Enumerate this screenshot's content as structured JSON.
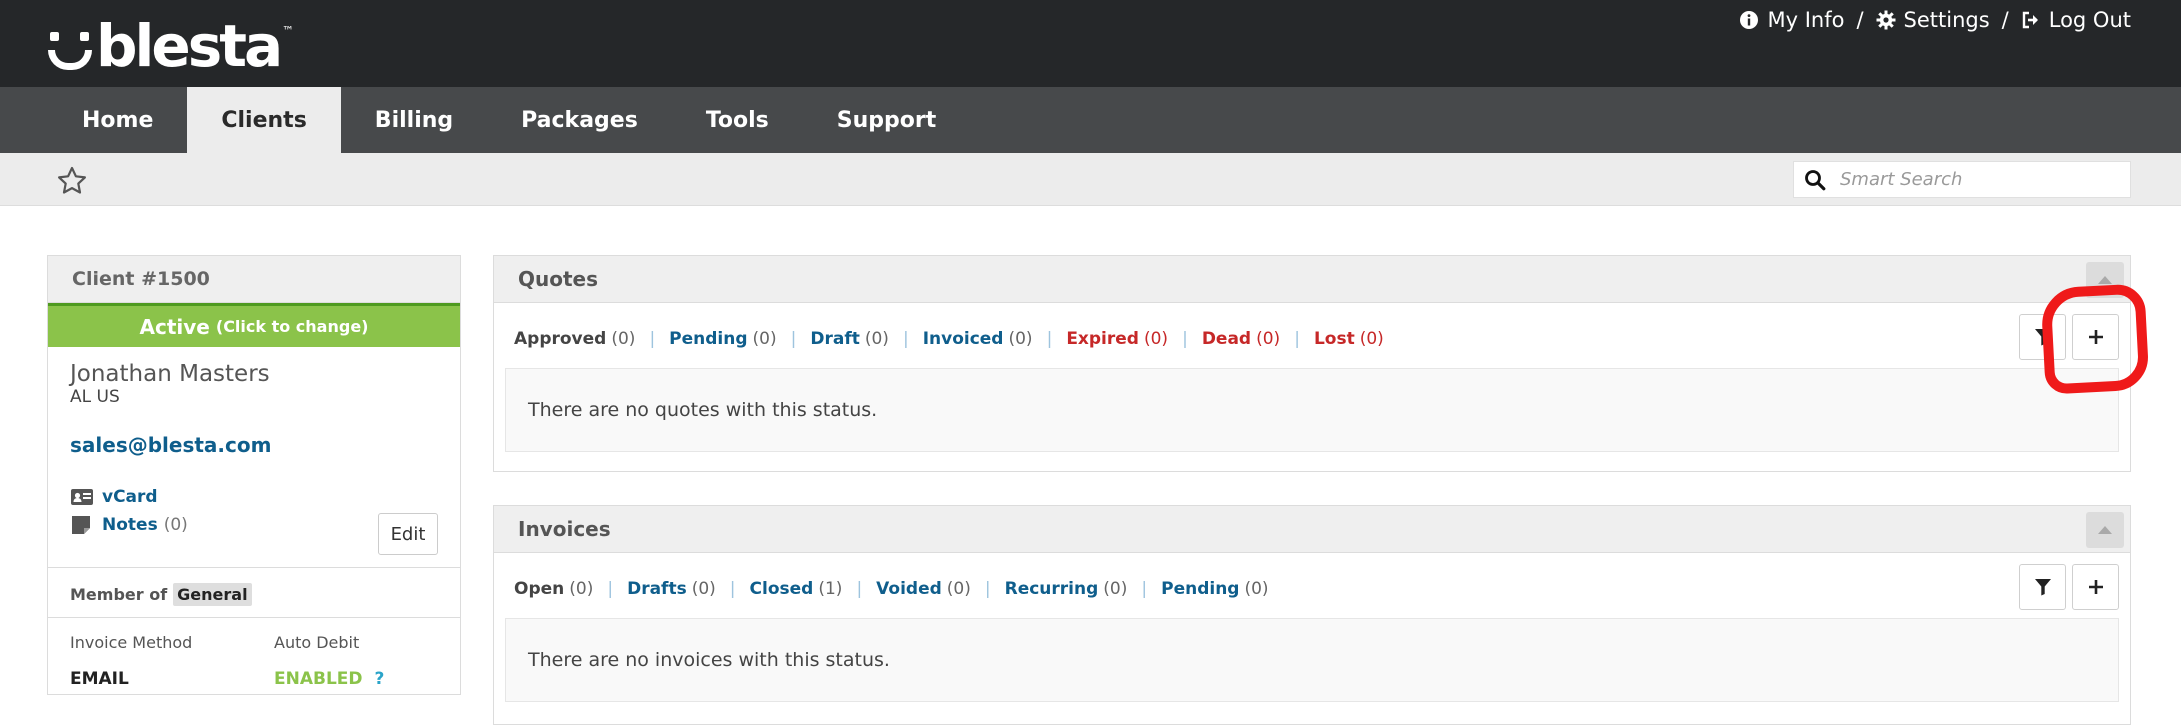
{
  "header": {
    "logo_text": "blesta",
    "logo_tm": "™",
    "links": [
      {
        "label": "My Info",
        "icon": "info-icon"
      },
      {
        "label": "Settings",
        "icon": "gear-icon"
      },
      {
        "label": "Log Out",
        "icon": "logout-icon"
      }
    ],
    "separator": "/"
  },
  "nav": {
    "items": [
      "Home",
      "Clients",
      "Billing",
      "Packages",
      "Tools",
      "Support"
    ],
    "active": "Clients"
  },
  "subbar": {
    "search_placeholder": "Smart Search"
  },
  "client": {
    "title": "Client #1500",
    "status": "Active",
    "status_hint": "(Click to change)",
    "name": "Jonathan Masters",
    "location": "AL US",
    "email": "sales@blesta.com",
    "vcard_label": "vCard",
    "notes_label": "Notes",
    "notes_count": "(0)",
    "edit_label": "Edit",
    "member_of_label": "Member of",
    "group": "General",
    "invoice_method_label": "Invoice Method",
    "invoice_method_value": "EMAIL",
    "auto_debit_label": "Auto Debit",
    "auto_debit_value": "ENABLED",
    "auto_debit_help": "?"
  },
  "quotes": {
    "title": "Quotes",
    "filters": [
      {
        "label": "Approved",
        "count": "(0)",
        "style": "dark"
      },
      {
        "label": "Pending",
        "count": "(0)",
        "style": "blue"
      },
      {
        "label": "Draft",
        "count": "(0)",
        "style": "blue"
      },
      {
        "label": "Invoiced",
        "count": "(0)",
        "style": "blue"
      },
      {
        "label": "Expired",
        "count": "(0)",
        "style": "red"
      },
      {
        "label": "Dead",
        "count": "(0)",
        "style": "red"
      },
      {
        "label": "Lost",
        "count": "(0)",
        "style": "red"
      }
    ],
    "empty_text": "There are no quotes with this status."
  },
  "invoices": {
    "title": "Invoices",
    "filters": [
      {
        "label": "Open",
        "count": "(0)",
        "style": "dark"
      },
      {
        "label": "Drafts",
        "count": "(0)",
        "style": "blue"
      },
      {
        "label": "Closed",
        "count": "(1)",
        "style": "blue"
      },
      {
        "label": "Voided",
        "count": "(0)",
        "style": "blue"
      },
      {
        "label": "Recurring",
        "count": "(0)",
        "style": "blue"
      },
      {
        "label": "Pending",
        "count": "(0)",
        "style": "blue"
      }
    ],
    "empty_text": "There are no invoices with this status."
  },
  "colors": {
    "header_bg": "#252729",
    "nav_bg": "#47494b",
    "status_green": "#8bc34a",
    "link_blue": "#0f5e8c",
    "danger_red": "#c62828",
    "annotation_red": "#ef1a1a"
  }
}
